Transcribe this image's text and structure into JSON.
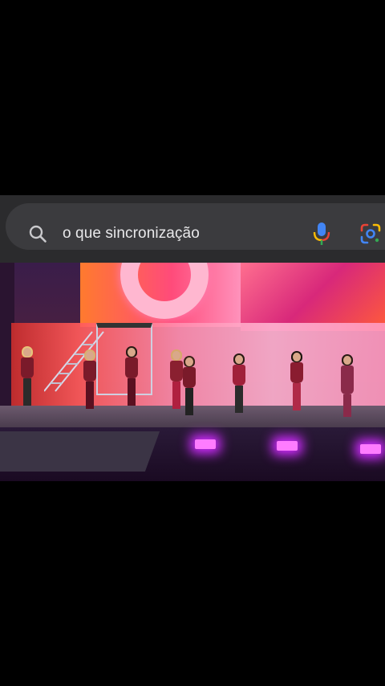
{
  "search": {
    "query": "o que sincronização"
  },
  "icons": {
    "search": "search-icon",
    "mic": "microphone-icon",
    "lens": "google-lens-icon"
  },
  "colors": {
    "panel": "#2b2b2d",
    "pill": "#3b3b3e",
    "query_text": "#e8e8ea",
    "mic_blue": "#4285f4",
    "mic_red": "#ea4335",
    "mic_yellow": "#fbbc05",
    "mic_green": "#34a853"
  },
  "video": {
    "description_visible": false
  }
}
